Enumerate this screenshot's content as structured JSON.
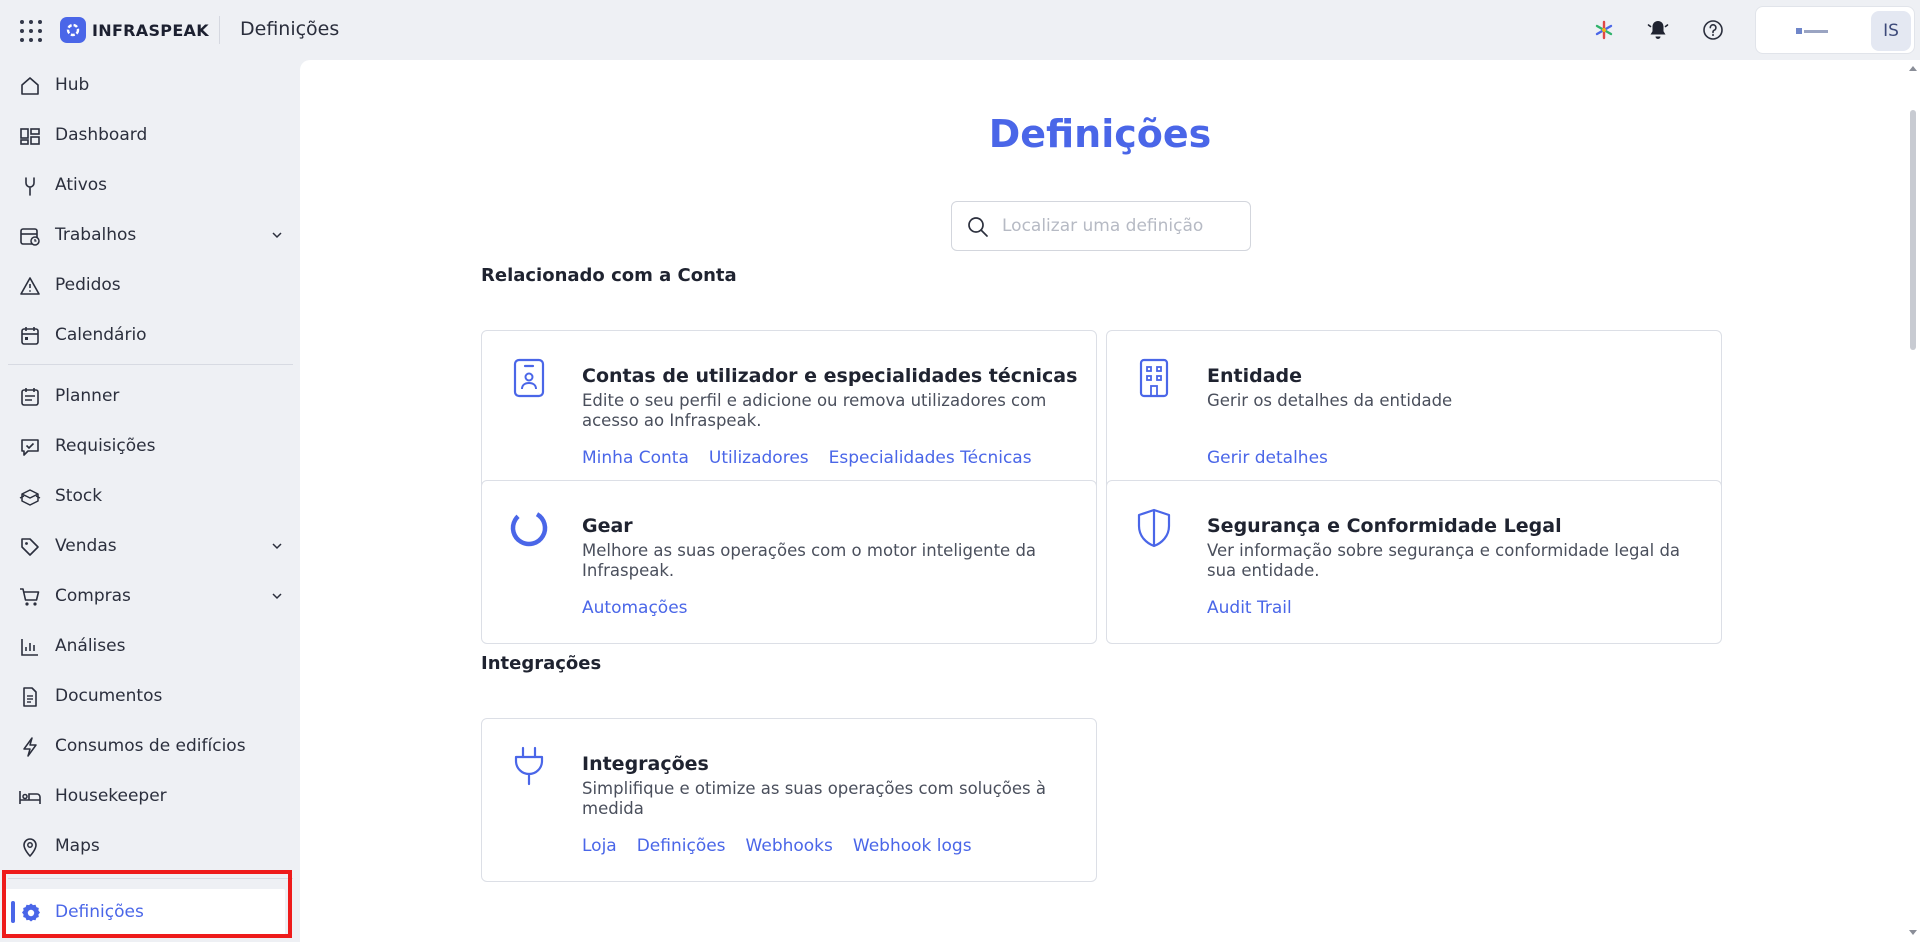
{
  "header": {
    "brand": "INFRASPEAK",
    "page_title": "Definições",
    "avatar_initials": "IS",
    "accent_color": "#4a66e8"
  },
  "sidebar": {
    "items": [
      {
        "label": "Hub",
        "icon": "home-icon"
      },
      {
        "label": "Dashboard",
        "icon": "dashboard-icon"
      },
      {
        "label": "Ativos",
        "icon": "wrench-icon"
      },
      {
        "label": "Trabalhos",
        "icon": "calendar-clock-icon",
        "expandable": true
      },
      {
        "label": "Pedidos",
        "icon": "warning-triangle-icon"
      },
      {
        "label": "Calendário",
        "icon": "calendar-icon"
      },
      {
        "label": "Planner",
        "icon": "planner-icon"
      },
      {
        "label": "Requisições",
        "icon": "chat-check-icon"
      },
      {
        "label": "Stock",
        "icon": "boxes-icon"
      },
      {
        "label": "Vendas",
        "icon": "tag-icon",
        "expandable": true
      },
      {
        "label": "Compras",
        "icon": "cart-icon",
        "expandable": true
      },
      {
        "label": "Análises",
        "icon": "bar-chart-icon"
      },
      {
        "label": "Documentos",
        "icon": "document-icon"
      },
      {
        "label": "Consumos de edifícios",
        "icon": "lightning-icon"
      },
      {
        "label": "Housekeeper",
        "icon": "bed-icon"
      },
      {
        "label": "Maps",
        "icon": "map-pin-icon"
      }
    ],
    "active_item": {
      "label": "Definições",
      "icon": "gear-icon"
    }
  },
  "main": {
    "title": "Definições",
    "search": {
      "placeholder": "Localizar uma definição",
      "value": ""
    },
    "sections": [
      {
        "title": "Relacionado com a Conta",
        "cards": [
          {
            "title": "Contas de utilizador e especialidades técnicas",
            "description": "Edite o seu perfil e adicione ou remova utilizadores com acesso ao Infraspeak.",
            "icon": "id-badge-icon",
            "links": [
              "Minha Conta",
              "Utilizadores",
              "Especialidades Técnicas"
            ]
          },
          {
            "title": "Entidade",
            "description": "Gerir os detalhes da entidade",
            "icon": "building-icon",
            "links": [
              "Gerir detalhes"
            ]
          },
          {
            "title": "Gear",
            "description": "Melhore as suas operações com o motor inteligente da Infraspeak.",
            "icon": "gear-ring-icon",
            "links": [
              "Automações"
            ]
          },
          {
            "title": "Segurança e Conformidade Legal",
            "description": "Ver informação sobre segurança e conformidade legal da sua entidade.",
            "icon": "shield-icon",
            "links": [
              "Audit Trail"
            ]
          }
        ]
      },
      {
        "title": "Integrações",
        "cards": [
          {
            "title": "Integrações",
            "description": "Simplifique e otimize as suas operações com soluções à medida",
            "icon": "plug-icon",
            "links": [
              "Loja",
              "Definições",
              "Webhooks",
              "Webhook logs"
            ]
          }
        ]
      }
    ]
  }
}
